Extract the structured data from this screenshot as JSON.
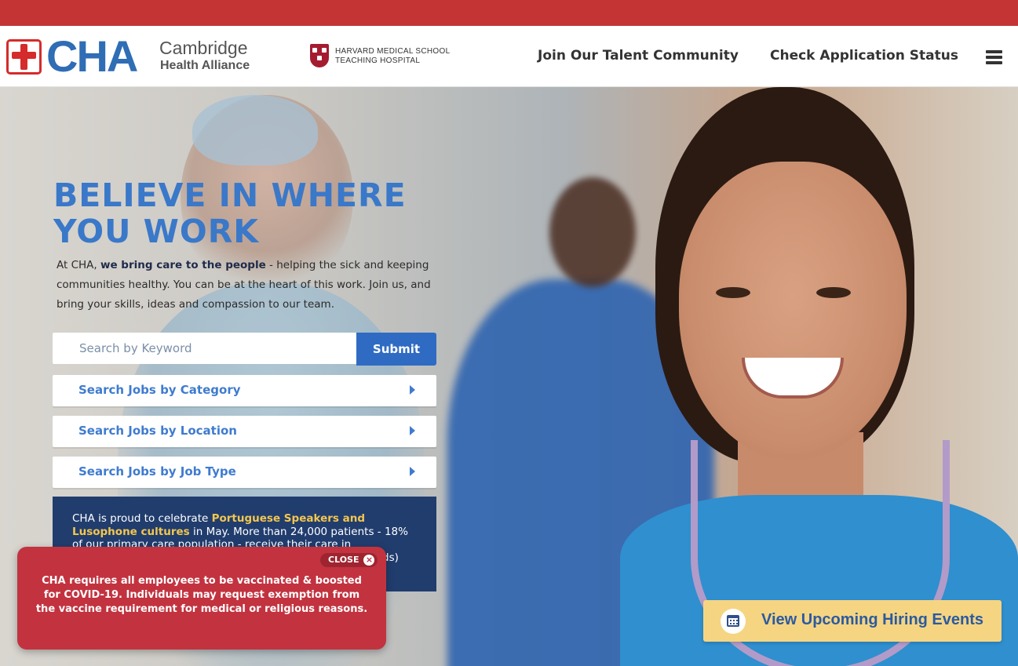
{
  "header": {
    "logo_text": "CHA",
    "logo_line1": "Cambridge",
    "logo_line2": "Health Alliance",
    "harvard_line1": "HARVARD MEDICAL SCHOOL",
    "harvard_line2": "TEACHING HOSPITAL",
    "nav": {
      "talent_community": "Join Our Talent Community",
      "application_status": "Check Application Status"
    }
  },
  "hero": {
    "headline": "BELIEVE IN WHERE YOU WORK",
    "intro_prefix": "At CHA, ",
    "intro_bold": "we bring care to the people",
    "intro_suffix": " - helping the sick and keeping communities healthy. You can be at the heart of this work. Join us, and bring your skills, ideas and compassion to our team.",
    "search": {
      "placeholder": "Search by Keyword",
      "value": "",
      "submit_label": "Submit"
    },
    "dropdowns": [
      {
        "label": "Search Jobs by Category"
      },
      {
        "label": "Search Jobs by Location"
      },
      {
        "label": "Search Jobs by Job Type"
      }
    ],
    "promo": {
      "prefix": "CHA is proud to celebrate ",
      "highlight": "Portuguese Speakers and Lusophone cultures",
      "suffix": " in May. More than 24,000 patients - 18% of our primary care population - receive their care in",
      "hidden_tail": "ds)"
    }
  },
  "covid_banner": {
    "close_label": "CLOSE",
    "text": "CHA requires all employees to be vaccinated & boosted for COVID-19. Individuals may request exemption from the vaccine requirement for medical or religious reasons."
  },
  "events_button": {
    "label": "View Upcoming Hiring Events",
    "icon": "calendar-icon"
  },
  "colors": {
    "topbar": "#c43434",
    "brand_blue": "#2f6db5",
    "submit_blue": "#2f6bc3",
    "promo_bg": "#213d6e",
    "promo_highlight": "#f3c64e",
    "covid_bg": "#c2333f",
    "events_bg": "#f5d582"
  }
}
